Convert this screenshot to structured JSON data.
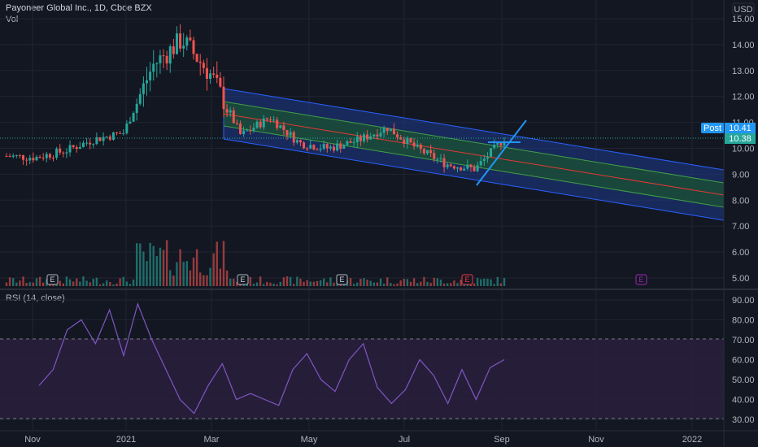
{
  "header": {
    "symbol_line": "Payoneer Global Inc., 1D, Cboe BZX",
    "volume_label": "Vol",
    "currency": "USD"
  },
  "price_labels": {
    "post_tag": "Post",
    "post_price": "10.41",
    "last_price": "10.38"
  },
  "rsi": {
    "title": "RSI (14, close)",
    "upper_band": 70,
    "lower_band": 30
  },
  "earnings_marker": "E",
  "colors": {
    "background": "#131722",
    "grid": "#1f2430",
    "up_candle": "#26a69a",
    "down_candle": "#ef5350",
    "channel_fill": "#1e3a8a",
    "channel_border": "#2962ff",
    "channel_mid_fill": "#2e7d32",
    "channel_center": "#e53935",
    "trendline": "#2196f3",
    "rsi_line": "#7e57c2",
    "rsi_band_fill": "#311b4f",
    "earnings_red": "#f23645",
    "earnings_purple": "#9c27b0"
  },
  "chart_data": [
    {
      "type": "candlestick",
      "title": "Payoneer Global Inc., 1D, Cboe BZX",
      "ylabel": "USD",
      "x_ticks": [
        "Nov",
        "2021",
        "Mar",
        "May",
        "Jul",
        "Sep",
        "Nov",
        "2022"
      ],
      "y_ticks": [
        5.0,
        6.0,
        7.0,
        8.0,
        9.0,
        10.0,
        11.0,
        12.0,
        13.0,
        14.0,
        15.0
      ],
      "ylim": [
        4.8,
        15.4
      ],
      "approx_close_path": [
        {
          "x": "Oct",
          "y": 9.7
        },
        {
          "x": "Nov",
          "y": 9.65
        },
        {
          "x": "Dec",
          "y": 9.9
        },
        {
          "x": "2021",
          "y": 10.35
        },
        {
          "x": "Jan mid",
          "y": 10.6
        },
        {
          "x": "Jan late",
          "y": 13.2
        },
        {
          "x": "Feb",
          "y": 14.2
        },
        {
          "x": "Feb mid",
          "y": 12.8
        },
        {
          "x": "Mar",
          "y": 10.5
        },
        {
          "x": "Mar mid",
          "y": 11.2
        },
        {
          "x": "Apr",
          "y": 10.2
        },
        {
          "x": "May",
          "y": 10.0
        },
        {
          "x": "Jun",
          "y": 10.3
        },
        {
          "x": "Jun late",
          "y": 10.8
        },
        {
          "x": "Jul",
          "y": 10.0
        },
        {
          "x": "Aug",
          "y": 9.4
        },
        {
          "x": "Aug late",
          "y": 9.2
        },
        {
          "x": "Sep",
          "y": 10.38
        }
      ],
      "volume": "shown below price, largest spikes in late Jan 2021",
      "annotations": [
        "Post 10.41",
        "10.38",
        "Earnings markers E"
      ]
    },
    {
      "type": "line",
      "title": "RSI (14, close)",
      "y_ticks": [
        30.0,
        40.0,
        50.0,
        60.0,
        70.0,
        80.0,
        90.0
      ],
      "ylim": [
        27,
        93
      ],
      "band": [
        30,
        70
      ],
      "approx_path": [
        47,
        55,
        75,
        80,
        68,
        85,
        62,
        88,
        70,
        55,
        40,
        33,
        47,
        58,
        40,
        43,
        40,
        37,
        55,
        63,
        50,
        44,
        60,
        68,
        46,
        38,
        45,
        60,
        52,
        38,
        55,
        40,
        56,
        60
      ]
    }
  ]
}
